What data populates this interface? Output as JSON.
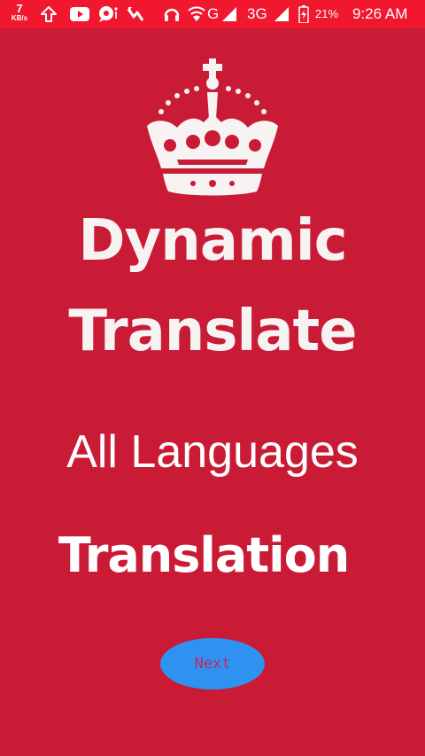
{
  "status_bar": {
    "net_speed_value": "7",
    "net_speed_unit": "KB/s",
    "network_label_g": "G",
    "network_label_3g": "3G",
    "battery_percent": "21%",
    "time": "9:26 AM",
    "icons": [
      "upload-arrow-icon",
      "youtube-icon",
      "chat-icon",
      "messenger-icon",
      "headset-icon",
      "wifi-icon",
      "signal-icon",
      "battery-icon"
    ]
  },
  "main": {
    "logo_icon": "crown-icon",
    "title_line1": "Dynamic",
    "title_line2": "Translate",
    "subtitle": "All Languages",
    "tagline": "Translation",
    "next_label": "Next"
  },
  "colors": {
    "background": "#c91b35",
    "status_bar": "#f0172e",
    "button": "#2e93f0",
    "button_text": "#c7255d"
  }
}
